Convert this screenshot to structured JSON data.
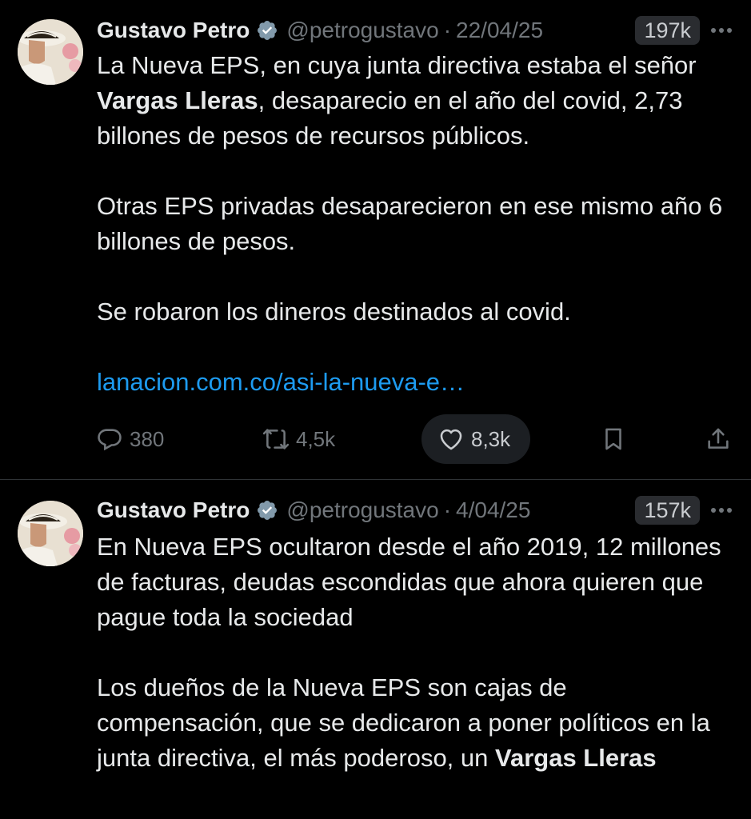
{
  "tweets": [
    {
      "author_name": "Gustavo Petro",
      "handle": "@petrogustavo",
      "separator": "·",
      "date": "22/04/25",
      "views": "197k",
      "paragraphs": [
        {
          "segments": [
            {
              "text": "La Nueva EPS, en cuya junta directiva estaba el señor ",
              "bold": false
            },
            {
              "text": "Vargas Lleras",
              "bold": true
            },
            {
              "text": ", desaparecio en el año del covid, 2,73 billones de pesos de recursos públicos.",
              "bold": false
            }
          ]
        },
        {
          "segments": [
            {
              "text": "Otras EPS privadas desaparecieron en ese mismo año 6 billones de pesos.",
              "bold": false
            }
          ]
        },
        {
          "segments": [
            {
              "text": "Se robaron los dineros destinados al covid.",
              "bold": false
            }
          ]
        }
      ],
      "link_text": "lanacion.com.co/asi-la-nueva-e…",
      "actions": {
        "replies": "380",
        "retweets": "4,5k",
        "likes": "8,3k"
      }
    },
    {
      "author_name": "Gustavo Petro",
      "handle": "@petrogustavo",
      "separator": "·",
      "date": "4/04/25",
      "views": "157k",
      "paragraphs": [
        {
          "segments": [
            {
              "text": "En Nueva EPS ocultaron desde el año 2019, 12 millones de facturas, deudas escondidas que ahora quieren que pague toda la sociedad",
              "bold": false
            }
          ]
        },
        {
          "segments": [
            {
              "text": "Los dueños de la Nueva EPS son cajas de compensación,  que se dedicaron a poner políticos en la junta directiva, el más poderoso, un ",
              "bold": false
            },
            {
              "text": "Vargas Lleras",
              "bold": true
            }
          ]
        }
      ]
    }
  ],
  "icons": {
    "verified": "verified-badge-icon",
    "more": "more-options-icon",
    "reply": "reply-icon",
    "retweet": "retweet-icon",
    "like": "heart-icon",
    "bookmark": "bookmark-icon",
    "share": "share-icon"
  },
  "colors": {
    "background": "#000000",
    "text": "#e7e9ea",
    "muted": "#71767b",
    "link": "#1d9bf0",
    "divider": "#2f3336"
  }
}
